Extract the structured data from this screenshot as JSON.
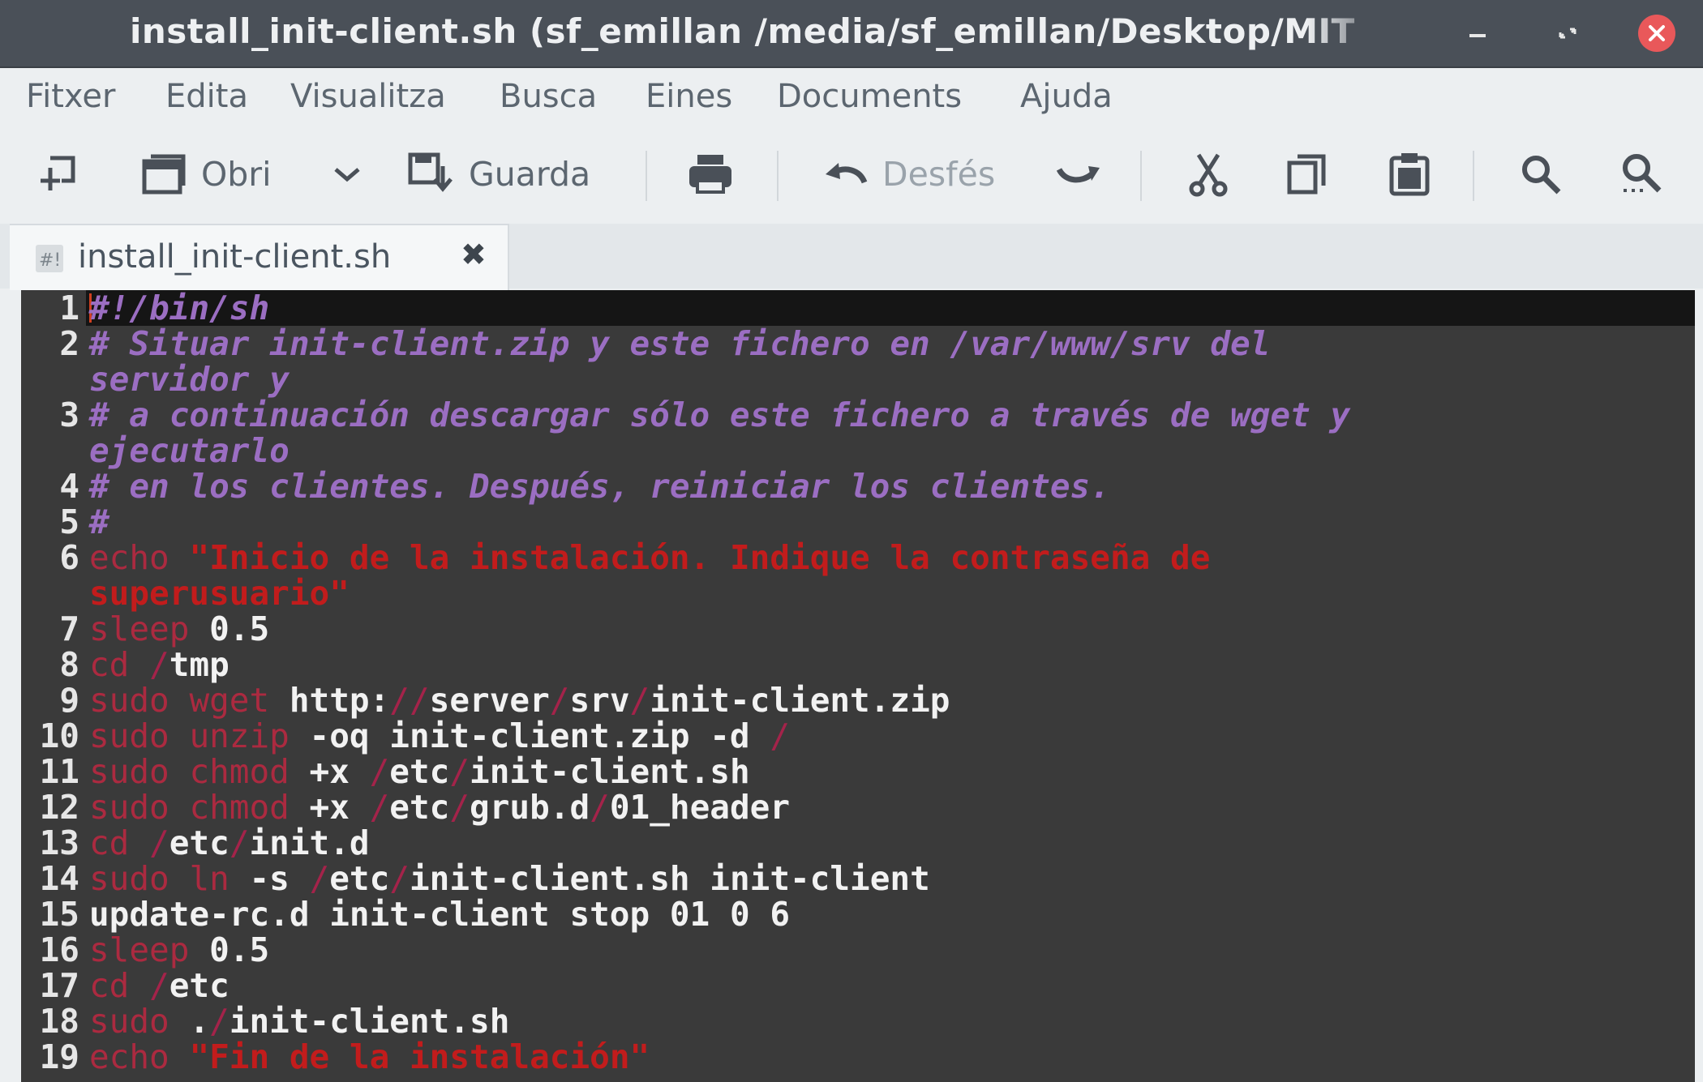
{
  "window": {
    "title": "install_init-client.sh (sf_emillan /media/sf_emillan/Desktop/MIT"
  },
  "menu": [
    "Fitxer",
    "Edita",
    "Visualitza",
    "Busca",
    "Eines",
    "Documents",
    "Ajuda"
  ],
  "toolbar": {
    "open_label": "Obri",
    "save_label": "Guarda",
    "undo_label": "Desfés"
  },
  "tab": {
    "label": "install_init-client.sh",
    "close": "✖",
    "icon": "#!"
  },
  "editor": {
    "current_line": 1,
    "line_numbers": [
      "1",
      "2",
      "3",
      "4",
      "5",
      "6",
      "7",
      "8",
      "9",
      "10",
      "11",
      "12",
      "13",
      "14",
      "15",
      "16",
      "17",
      "18",
      "19"
    ],
    "lines": [
      "#!/bin/sh",
      "# Situar init-client.zip y este fichero en /var/www/srv del",
      "servidor y",
      "# a continuación descargar sólo este fichero a través de wget y",
      "ejecutarlo",
      "# en los clientes. Después, reiniciar los clientes.",
      "#",
      "echo \"Inicio de la instalación. Indique la contraseña de",
      "superusuario\"",
      "sleep 0.5",
      "cd /tmp",
      "sudo wget http://server/srv/init-client.zip",
      "sudo unzip -oq init-client.zip -d /",
      "sudo chmod +x /etc/init-client.sh",
      "sudo chmod +x /etc/grub.d/01_header",
      "cd /etc/init.d",
      "sudo ln -s /etc/init-client.sh init-client",
      "update-rc.d init-client stop 01 0 6",
      "sleep 0.5",
      "cd /etc",
      "sudo ./init-client.sh",
      "echo \"Fin de la instalación\""
    ]
  },
  "colors": {
    "titlebar": "#4a5058",
    "editor_bg": "#3a3a3a",
    "comment": "#9b6ec2",
    "string": "#c21c1c",
    "keyword": "#ab2a40",
    "close_button": "#e9585a"
  }
}
